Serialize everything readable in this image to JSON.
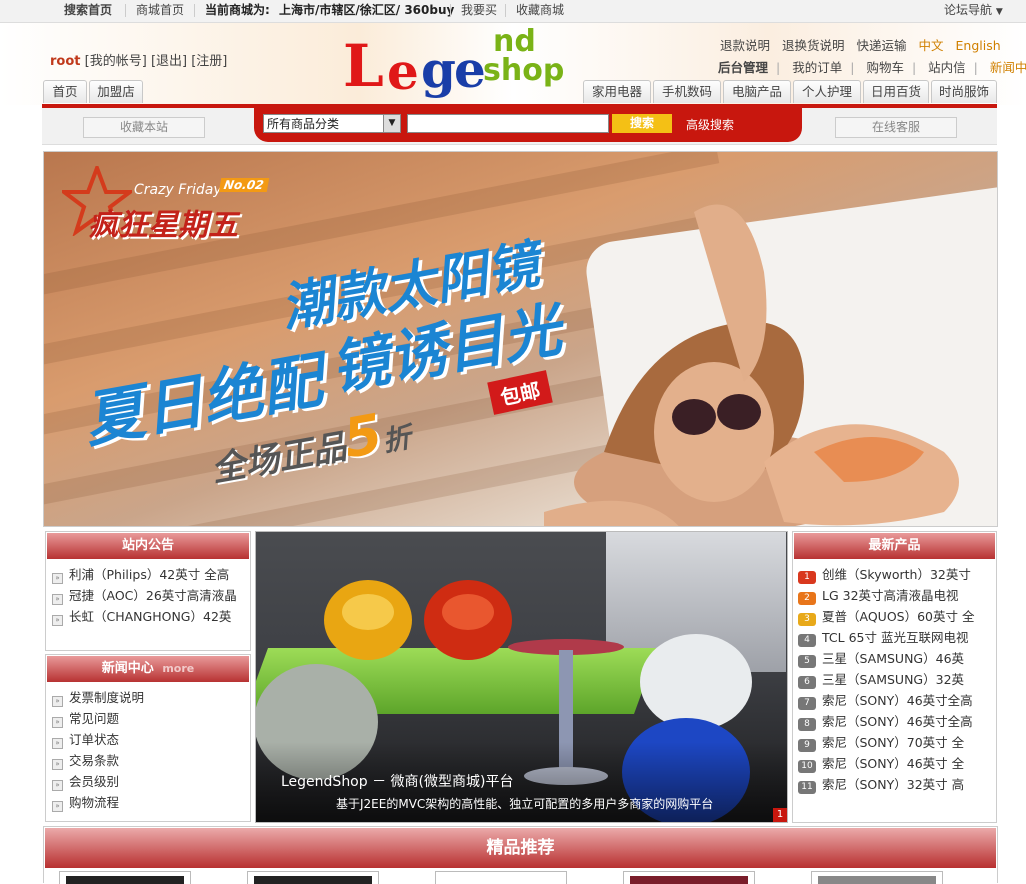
{
  "topbar": {
    "search_home": "搜索首页",
    "mall_home": "商城首页",
    "current_mall_label": "当前商城为:",
    "current_mall_value": "上海市/市辖区/徐汇区/ 360buy",
    "want_buy": "我要买",
    "favorite_mall": "收藏商城",
    "forum_nav": "论坛导航"
  },
  "user": {
    "name": "root",
    "my_account": "[我的帐号]",
    "logout": "[退出]",
    "register": "[注册]"
  },
  "logo": {
    "part_l": "L",
    "part_e": "e",
    "part_ge": "ge",
    "part_nd": "nd",
    "part_shop": "shop"
  },
  "header_links_row1": [
    "退款说明",
    "退换货说明",
    "快递运输"
  ],
  "lang": {
    "zh": "中文",
    "en": "English"
  },
  "header_links_row2": [
    "后台管理",
    "我的订单",
    "购物车",
    "站内信",
    "新闻中心"
  ],
  "nav_left": [
    "首页",
    "加盟店"
  ],
  "nav_right": [
    "家用电器",
    "手机数码",
    "电脑产品",
    "个人护理",
    "日用百货",
    "时尚服饰"
  ],
  "search": {
    "bookmark_site": "收藏本站",
    "category_selected": "所有商品分类",
    "input_value": "",
    "button": "搜索",
    "advanced": "高级搜索",
    "online_service": "在线客服"
  },
  "banner": {
    "crazy_friday_en": "Crazy Friday",
    "badge": "No.02",
    "crazy_friday_cn": "疯狂星期五",
    "headline1": "潮款太阳镜",
    "headline2a": "夏日绝配",
    "headline2b": "镜诱目光",
    "free_shipping": "包邮",
    "discount_prefix": "全场正品",
    "discount_num": "5",
    "discount_suffix": "折"
  },
  "announcements": {
    "title": "站内公告",
    "items": [
      "利浦（Philips）42英寸 全高",
      "冠捷（AOC）26英寸高清液晶",
      "长虹（CHANGHONG）42英"
    ]
  },
  "news": {
    "title": "新闻中心",
    "more": "more",
    "items": [
      "发票制度说明",
      "常见问题",
      "订单状态",
      "交易条款",
      "会员级别",
      "购物流程"
    ]
  },
  "slide": {
    "caption_title": "LegendShop － 微商(微型商城)平台",
    "caption_sub": "基于J2EE的MVC架构的高性能、独立可配置的多用户多商家的网购平台",
    "page_num": "1"
  },
  "latest": {
    "title": "最新产品",
    "items": [
      {
        "n": "1",
        "text": "创维（Skyworth）32英寸",
        "color": "#d9381e"
      },
      {
        "n": "2",
        "text": "LG 32英寸高清液晶电视",
        "color": "#e8751a"
      },
      {
        "n": "3",
        "text": "夏普（AQUOS）60英寸 全",
        "color": "#e8a91a"
      },
      {
        "n": "4",
        "text": "TCL 65寸 蓝光互联网电视",
        "color": "#777777"
      },
      {
        "n": "5",
        "text": "三星（SAMSUNG）46英",
        "color": "#777777"
      },
      {
        "n": "6",
        "text": "三星（SAMSUNG）32英",
        "color": "#777777"
      },
      {
        "n": "7",
        "text": "索尼（SONY）46英寸全高",
        "color": "#777777"
      },
      {
        "n": "8",
        "text": "索尼（SONY）46英寸全高",
        "color": "#777777"
      },
      {
        "n": "9",
        "text": "索尼（SONY）70英寸 全",
        "color": "#777777"
      },
      {
        "n": "10",
        "text": "索尼（SONY）46英寸 全",
        "color": "#777777"
      },
      {
        "n": "11",
        "text": "索尼（SONY）32英寸 高",
        "color": "#777777"
      }
    ]
  },
  "recommend": {
    "title": "精品推荐"
  },
  "colors": {
    "brand_red": "#c8170e",
    "search_yellow": "#f4c015",
    "lang_orange": "#d08000",
    "logo_green": "#7ab317",
    "logo_blue": "#1a3ea8"
  }
}
